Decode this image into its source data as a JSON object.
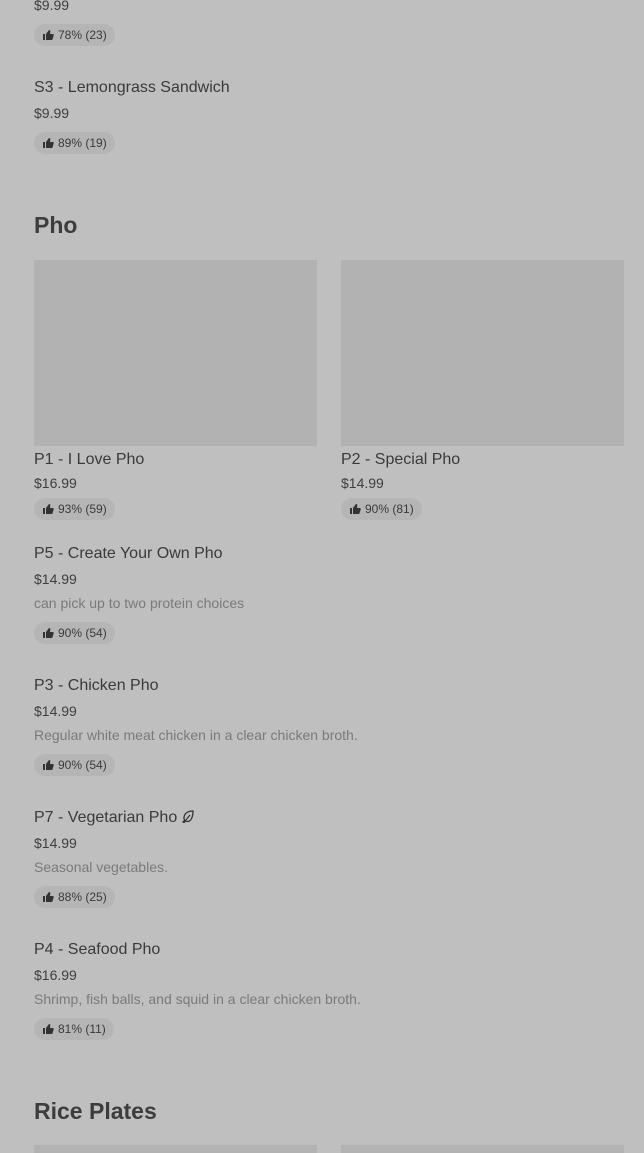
{
  "top_item": {
    "price": "$9.99",
    "rating": "78% (23)"
  },
  "items_top": [
    {
      "title": "S3 - Lemongrass Sandwich",
      "price": "$9.99",
      "rating": "89% (19)"
    }
  ],
  "sections": {
    "pho": "Pho",
    "rice": "Rice Plates"
  },
  "featured": [
    {
      "title": "P1 - I Love Pho",
      "price": "$16.99",
      "rating": "93% (59)"
    },
    {
      "title": "P2 - Special Pho",
      "price": "$14.99",
      "rating": "90% (81)"
    }
  ],
  "items": [
    {
      "title": "P5 - Create Your Own Pho",
      "price": "$14.99",
      "desc": "can pick up to two protein choices",
      "rating": "90% (54)"
    },
    {
      "title": "P3 - Chicken Pho",
      "price": "$14.99",
      "desc": "Regular white meat chicken in a clear chicken broth.",
      "rating": "90% (54)"
    },
    {
      "title": "P7 - Vegetarian Pho",
      "price": "$14.99",
      "desc": "Seasonal vegetables.",
      "rating": "88% (25)",
      "icon": "leaf-icon"
    },
    {
      "title": "P4 - Seafood Pho",
      "price": "$16.99",
      "desc": "Shrimp, fish balls, and squid in a clear chicken broth.",
      "rating": "81% (11)"
    }
  ],
  "colors": {
    "background": "#bfbfbf",
    "image_placeholder": "#b2b2b2",
    "badge": "#b5b5b5"
  }
}
